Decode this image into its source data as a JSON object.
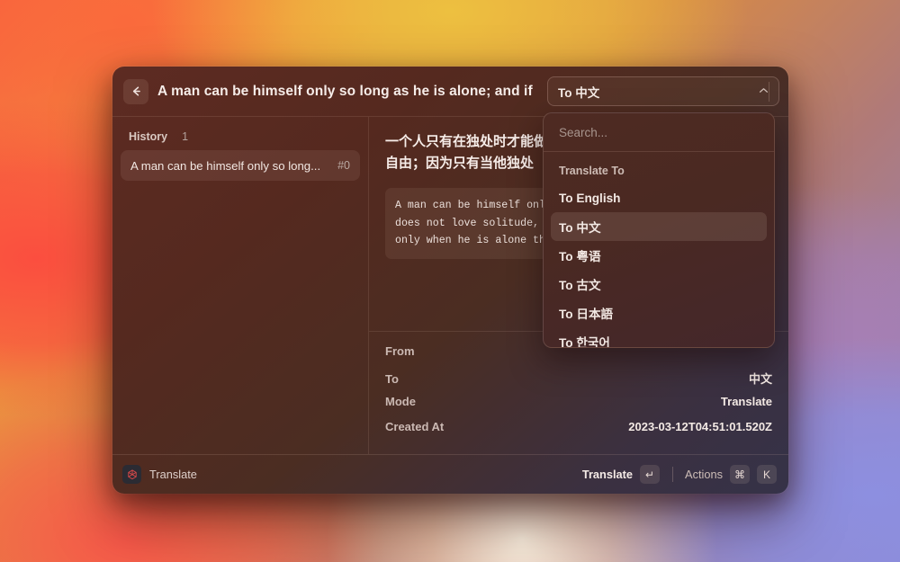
{
  "header": {
    "back_icon": "arrow-left-icon",
    "title": "A man can be himself only so long as he is alone; and if"
  },
  "language_selector": {
    "value": "To 中文",
    "chevron_icon": "chevron-up-icon",
    "search_placeholder": "Search...",
    "section_label": "Translate To",
    "options": [
      {
        "label": "To English",
        "selected": false
      },
      {
        "label": "To 中文",
        "selected": true
      },
      {
        "label": "To 粤语",
        "selected": false
      },
      {
        "label": "To 古文",
        "selected": false
      },
      {
        "label": "To 日本語",
        "selected": false
      },
      {
        "label": "To 한국어",
        "selected": false
      }
    ]
  },
  "sidebar": {
    "title": "History",
    "count": "1",
    "items": [
      {
        "label": "A man can be himself only so long...",
        "index": "#0"
      }
    ]
  },
  "detail": {
    "translated_text": "一个人只有在独处时才能做自\n自由；因为只有当他独处",
    "source_text": "A man can be himself only\ndoes not love solitude, h\nonly when he is alone tha",
    "meta": [
      {
        "key": "From",
        "value": ""
      },
      {
        "key": "To",
        "value": "中文"
      },
      {
        "key": "Mode",
        "value": "Translate"
      },
      {
        "key": "Created At",
        "value": "2023-03-12T04:51:01.520Z"
      }
    ]
  },
  "footer": {
    "app_icon": "openai-logo-icon",
    "app_name": "Translate",
    "primary_action": "Translate",
    "primary_key": "↵",
    "actions_label": "Actions",
    "actions_key_cmd": "⌘",
    "actions_key_letter": "K"
  },
  "colors": {
    "accent": "#f2e8e3",
    "panel": "#4e2a22",
    "wallpaper_warm": "#f8603f",
    "wallpaper_cool": "#8b86cf"
  }
}
